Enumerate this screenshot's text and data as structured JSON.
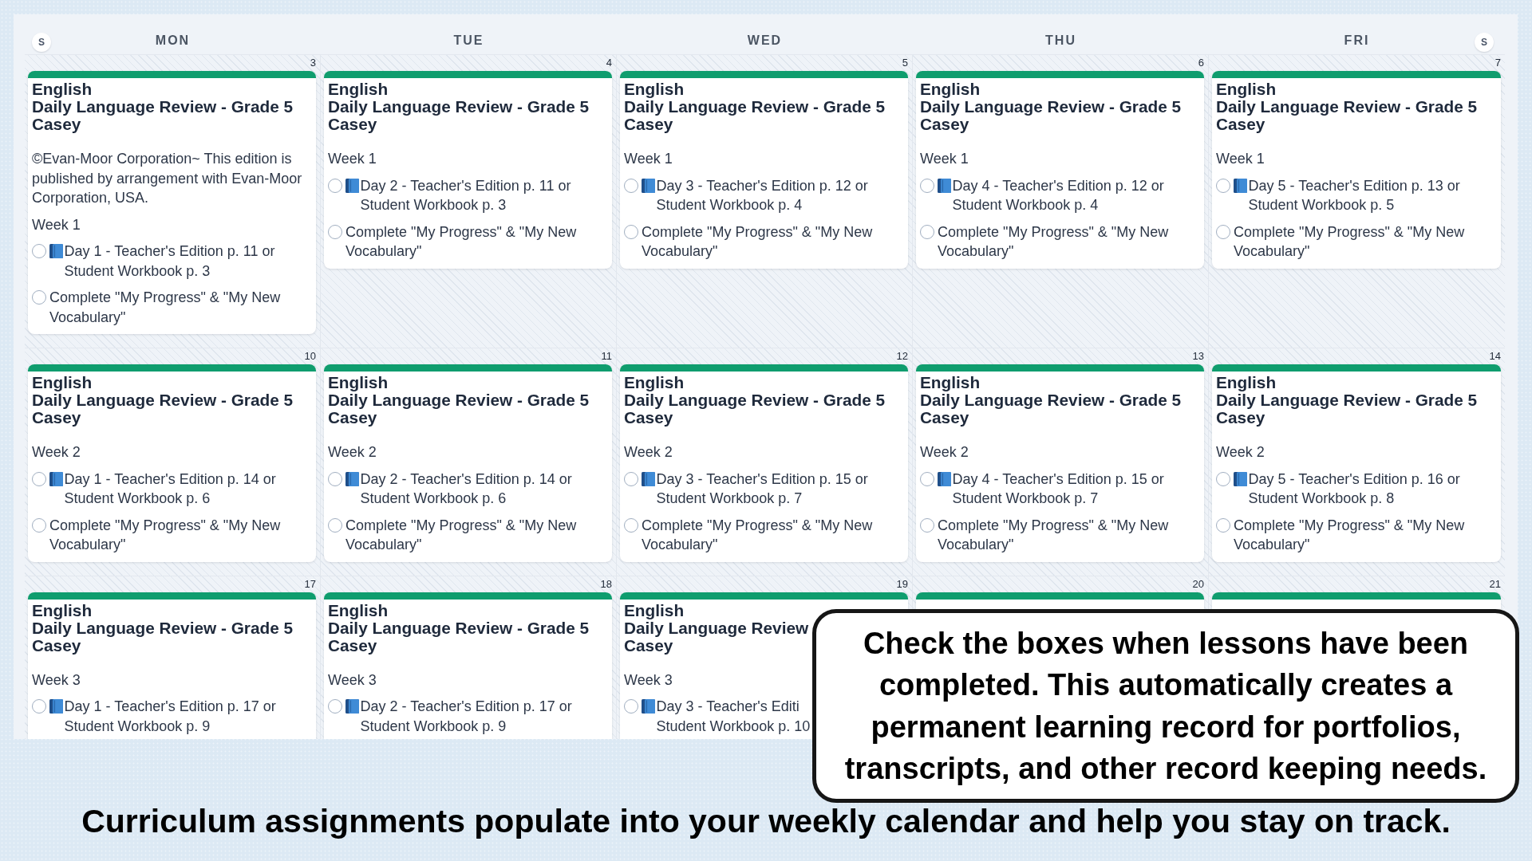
{
  "calendar": {
    "header": {
      "leading_toggle": "S",
      "days": [
        "MON",
        "TUE",
        "WED",
        "THU",
        "FRI"
      ],
      "trailing_toggle": "S"
    },
    "weeks": [
      {
        "days": [
          {
            "date": "3",
            "events": [
              {
                "color": "#0f9d6e",
                "subject": "English",
                "title": "Daily Language Review - Grade 5",
                "student": "Casey",
                "note": "©Evan-Moor Corporation~ This edition is published by arrangement with Evan-Moor Corporation, USA.",
                "week": "Week 1",
                "tasks": [
                  {
                    "kind": "lesson",
                    "text": "Day 1 - Teacher's Edition p. 11 or Student Workbook p. 3",
                    "checked": false
                  },
                  {
                    "kind": "activity",
                    "text": "Complete \"My Progress\" & \"My New Vocabulary\"",
                    "checked": false
                  }
                ]
              }
            ]
          },
          {
            "date": "4",
            "events": [
              {
                "color": "#0f9d6e",
                "subject": "English",
                "title": "Daily Language Review - Grade 5",
                "student": "Casey",
                "week": "Week 1",
                "tasks": [
                  {
                    "kind": "lesson",
                    "text": "Day 2 - Teacher's Edition p. 11 or Student Workbook p. 3",
                    "checked": false
                  },
                  {
                    "kind": "activity",
                    "text": "Complete \"My Progress\" & \"My New Vocabulary\"",
                    "checked": false
                  }
                ]
              }
            ]
          },
          {
            "date": "5",
            "events": [
              {
                "color": "#0f9d6e",
                "subject": "English",
                "title": "Daily Language Review - Grade 5",
                "student": "Casey",
                "week": "Week 1",
                "tasks": [
                  {
                    "kind": "lesson",
                    "text": "Day 3 - Teacher's Edition p. 12 or Student Workbook p. 4",
                    "checked": false
                  },
                  {
                    "kind": "activity",
                    "text": "Complete \"My Progress\" & \"My New Vocabulary\"",
                    "checked": false
                  }
                ]
              }
            ]
          },
          {
            "date": "6",
            "events": [
              {
                "color": "#0f9d6e",
                "subject": "English",
                "title": "Daily Language Review - Grade 5",
                "student": "Casey",
                "week": "Week 1",
                "tasks": [
                  {
                    "kind": "lesson",
                    "text": "Day 4 - Teacher's Edition p. 12 or Student Workbook p. 4",
                    "checked": false
                  },
                  {
                    "kind": "activity",
                    "text": "Complete \"My Progress\" & \"My New Vocabulary\"",
                    "checked": false
                  }
                ]
              }
            ]
          },
          {
            "date": "7",
            "events": [
              {
                "color": "#0f9d6e",
                "subject": "English",
                "title": "Daily Language Review - Grade 5",
                "student": "Casey",
                "week": "Week 1",
                "tasks": [
                  {
                    "kind": "lesson",
                    "text": "Day 5 - Teacher's Edition p. 13 or Student Workbook p. 5",
                    "checked": false
                  },
                  {
                    "kind": "activity",
                    "text": "Complete \"My Progress\" & \"My New Vocabulary\"",
                    "checked": false
                  }
                ]
              }
            ]
          }
        ]
      },
      {
        "days": [
          {
            "date": "10",
            "events": [
              {
                "color": "#0f9d6e",
                "subject": "English",
                "title": "Daily Language Review - Grade 5",
                "student": "Casey",
                "week": "Week 2",
                "tasks": [
                  {
                    "kind": "lesson",
                    "text": "Day 1 - Teacher's Edition p. 14 or Student Workbook p. 6",
                    "checked": false
                  },
                  {
                    "kind": "activity",
                    "text": "Complete \"My Progress\" & \"My New Vocabulary\"",
                    "checked": false
                  }
                ]
              }
            ]
          },
          {
            "date": "11",
            "events": [
              {
                "color": "#0f9d6e",
                "subject": "English",
                "title": "Daily Language Review - Grade 5",
                "student": "Casey",
                "week": "Week 2",
                "tasks": [
                  {
                    "kind": "lesson",
                    "text": "Day 2 - Teacher's Edition p. 14 or Student Workbook p. 6",
                    "checked": false
                  },
                  {
                    "kind": "activity",
                    "text": "Complete \"My Progress\" & \"My New Vocabulary\"",
                    "checked": false
                  }
                ]
              }
            ]
          },
          {
            "date": "12",
            "events": [
              {
                "color": "#0f9d6e",
                "subject": "English",
                "title": "Daily Language Review - Grade 5",
                "student": "Casey",
                "week": "Week 2",
                "tasks": [
                  {
                    "kind": "lesson",
                    "text": "Day 3 - Teacher's Edition p. 15 or Student Workbook p. 7",
                    "checked": false
                  },
                  {
                    "kind": "activity",
                    "text": "Complete \"My Progress\" & \"My New Vocabulary\"",
                    "checked": false
                  }
                ]
              }
            ]
          },
          {
            "date": "13",
            "events": [
              {
                "color": "#0f9d6e",
                "subject": "English",
                "title": "Daily Language Review - Grade 5",
                "student": "Casey",
                "week": "Week 2",
                "tasks": [
                  {
                    "kind": "lesson",
                    "text": "Day 4 - Teacher's Edition p. 15 or Student Workbook p. 7",
                    "checked": false
                  },
                  {
                    "kind": "activity",
                    "text": "Complete \"My Progress\" & \"My New Vocabulary\"",
                    "checked": false
                  }
                ]
              }
            ]
          },
          {
            "date": "14",
            "events": [
              {
                "color": "#0f9d6e",
                "subject": "English",
                "title": "Daily Language Review - Grade 5",
                "student": "Casey",
                "week": "Week 2",
                "tasks": [
                  {
                    "kind": "lesson",
                    "text": "Day 5 - Teacher's Edition p. 16 or Student Workbook p. 8",
                    "checked": false
                  },
                  {
                    "kind": "activity",
                    "text": "Complete \"My Progress\" & \"My New Vocabulary\"",
                    "checked": false
                  }
                ]
              }
            ]
          }
        ]
      },
      {
        "days": [
          {
            "date": "17",
            "events": [
              {
                "color": "#0f9d6e",
                "subject": "English",
                "title": "Daily Language Review - Grade 5",
                "student": "Casey",
                "week": "Week 3",
                "tasks": [
                  {
                    "kind": "lesson",
                    "text": "Day 1 - Teacher's Edition p. 17 or Student Workbook p. 9",
                    "checked": false
                  }
                ]
              }
            ]
          },
          {
            "date": "18",
            "events": [
              {
                "color": "#0f9d6e",
                "subject": "English",
                "title": "Daily Language Review - Grade 5",
                "student": "Casey",
                "week": "Week 3",
                "tasks": [
                  {
                    "kind": "lesson",
                    "text": "Day 2 - Teacher's Edition p. 17 or Student Workbook p. 9",
                    "checked": false
                  }
                ]
              }
            ]
          },
          {
            "date": "19",
            "events": [
              {
                "color": "#0f9d6e",
                "subject": "English",
                "title": "Daily Language Review",
                "student": "Casey",
                "week": "Week 3",
                "tasks": [
                  {
                    "kind": "lesson",
                    "text": "Day 3 - Teacher's Editi\nStudent Workbook p. 10",
                    "checked": false
                  }
                ]
              }
            ]
          },
          {
            "date": "20",
            "events": [
              {
                "color": "#0f9d6e"
              }
            ]
          },
          {
            "date": "21",
            "events": [
              {
                "color": "#0f9d6e"
              }
            ]
          }
        ]
      }
    ]
  },
  "callout": "Check the boxes when lessons have been completed. This automatically creates a permanent learning record for portfolios, transcripts, and other record keeping needs.",
  "caption": "Curriculum assignments populate into your weekly calendar and help you stay on track."
}
